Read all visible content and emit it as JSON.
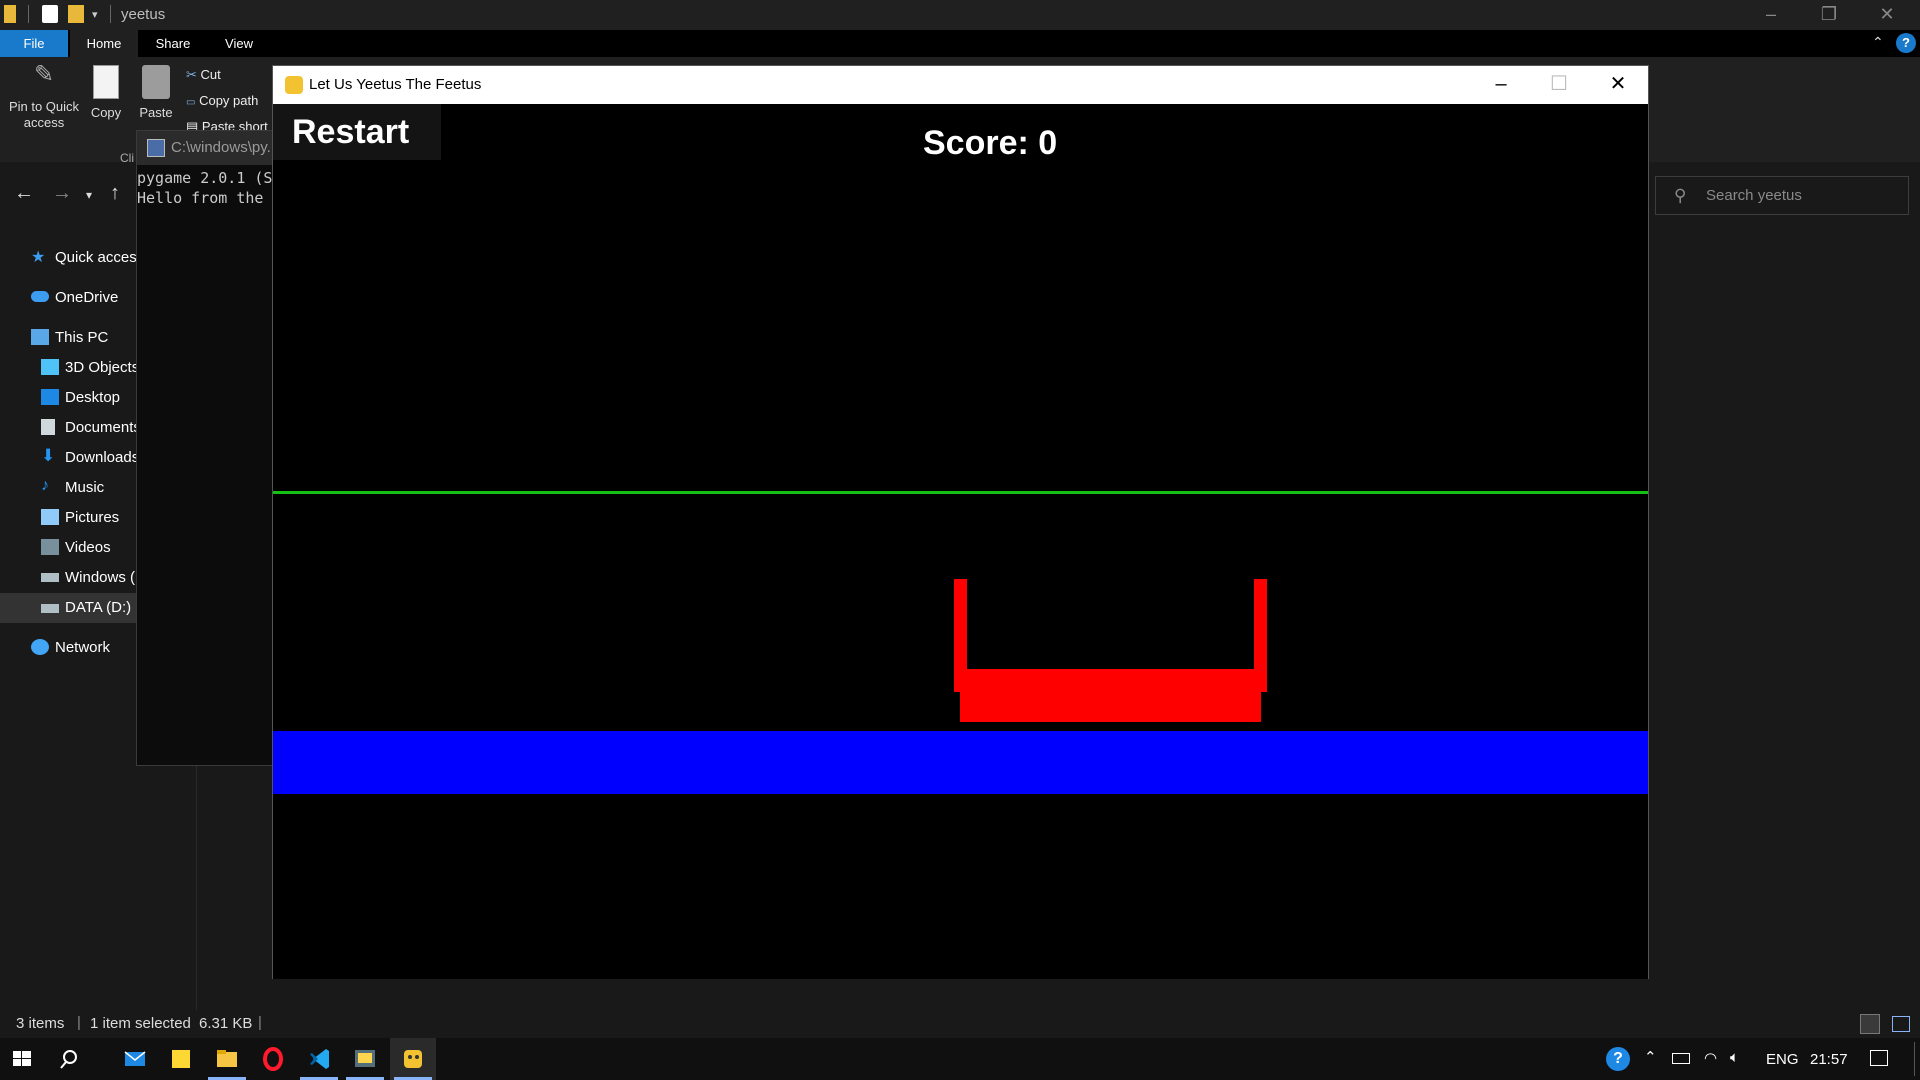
{
  "explorer": {
    "title": "yeetus",
    "tabs": [
      "File",
      "Home",
      "Share",
      "View"
    ],
    "ribbon": {
      "pin_label_1": "Pin to Quick",
      "pin_label_2": "access",
      "copy": "Copy",
      "paste": "Paste",
      "cut": "Cut",
      "copy_path": "Copy path",
      "paste_shortcut": "Paste short",
      "group_clipboard": "Cli"
    },
    "search_placeholder": "Search yeetus",
    "nav": {
      "quick_access": "Quick access",
      "onedrive": "OneDrive",
      "this_pc": "This PC",
      "objects3d": "3D Objects",
      "desktop": "Desktop",
      "documents": "Documents",
      "downloads": "Downloads",
      "music": "Music",
      "pictures": "Pictures",
      "videos": "Videos",
      "windows": "Windows (",
      "data": "DATA (D:)",
      "network": "Network"
    },
    "status": {
      "items": "3 items",
      "selected": "1 item selected",
      "size": "6.31 KB"
    }
  },
  "console": {
    "title": "C:\\windows\\py.",
    "lines": [
      "pygame 2.0.1 (S",
      "Hello from the"
    ]
  },
  "game": {
    "title": "Let Us Yeetus The Feetus",
    "restart_label": "Restart",
    "score_label": "Score: 0",
    "colors": {
      "background": "#000000",
      "goal_line": "#13c013",
      "floor": "#0000ff",
      "bucket": "#ff0000"
    }
  },
  "taskbar": {
    "apps": [
      "start-icon",
      "search-icon",
      "mail-icon",
      "sticky-notes-icon",
      "file-explorer-icon",
      "opera-icon",
      "vscode-icon",
      "python-console-icon",
      "pygame-icon"
    ],
    "tray": {
      "language": "ENG",
      "time": "21:57"
    }
  }
}
